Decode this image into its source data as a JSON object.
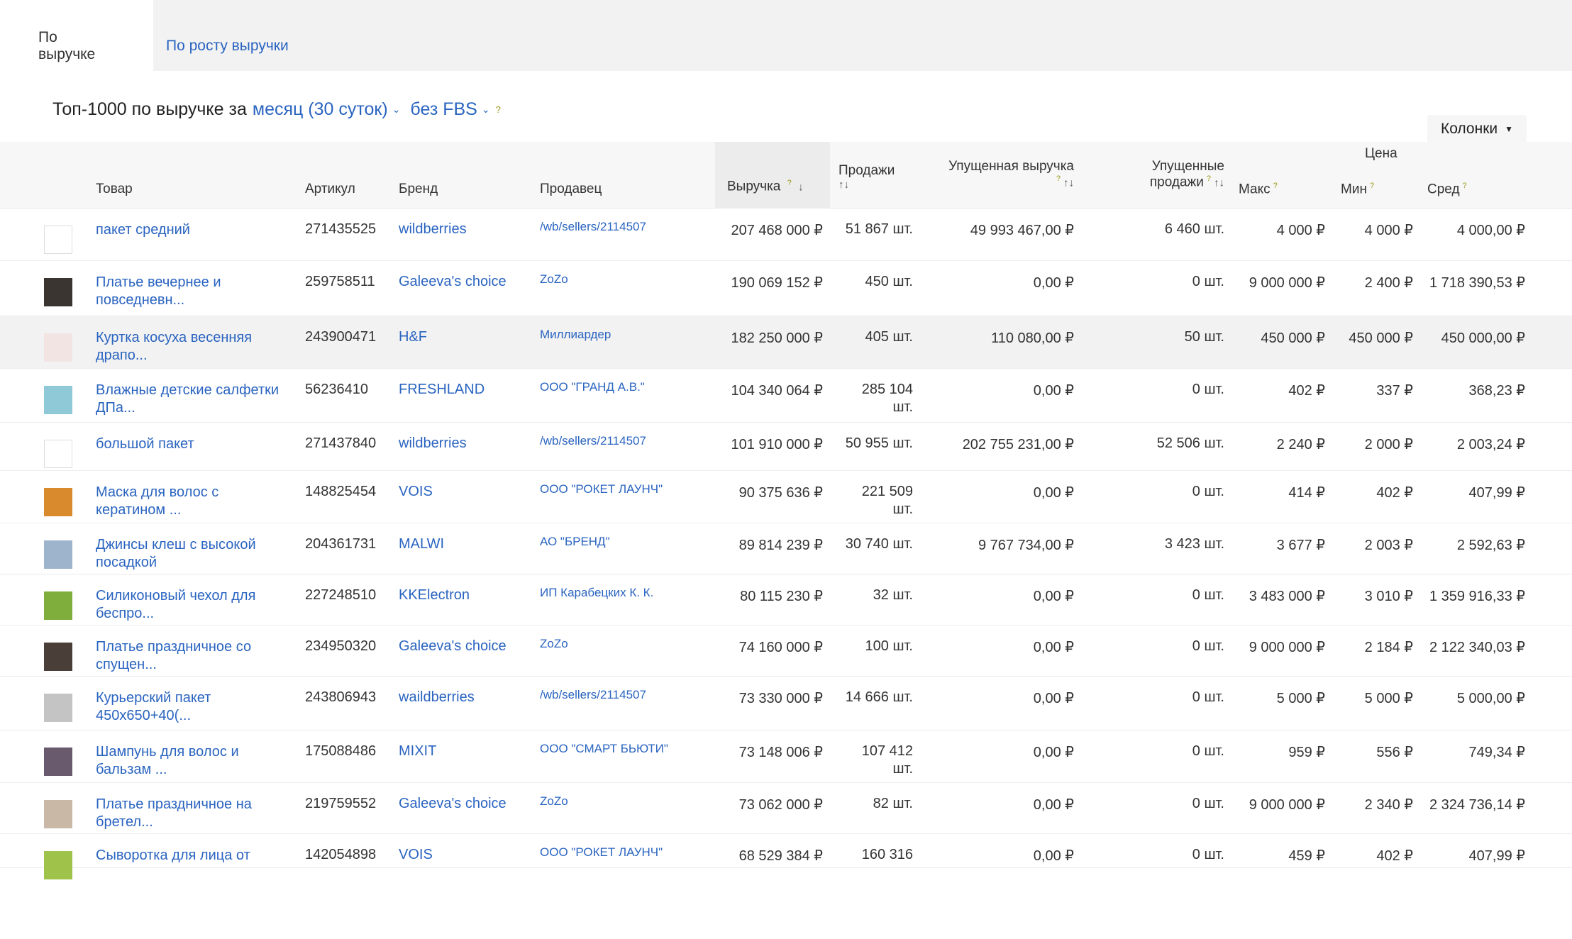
{
  "tabs": [
    {
      "label": "По выручке",
      "active": true
    },
    {
      "label": "По росту выручки",
      "active": false
    }
  ],
  "heading": {
    "prefix": "Топ-1000 по выручке за",
    "period": "месяц (30 суток)",
    "fbs": "без FBS",
    "help": "?"
  },
  "columns_button": "Колонки",
  "table": {
    "headers": {
      "product": "Товар",
      "article": "Артикул",
      "brand": "Бренд",
      "seller": "Продавец",
      "revenue": "Выручка",
      "sales": "Продажи",
      "lost_revenue": "Упущенная выручка",
      "lost_sales_1": "Упущенные",
      "lost_sales_2": "продажи",
      "price_group": "Цена",
      "price_max": "Макс",
      "price_min": "Мин",
      "price_avg": "Сред",
      "help": "?",
      "sort_desc": "↓",
      "sort_both": "↑↓"
    },
    "rows": [
      {
        "name": "пакет средний",
        "article": "271435525",
        "brand": "wildberries",
        "seller": "/wb/sellers/2114507",
        "revenue": "207 468 000 ₽",
        "sales": "51 867 шт.",
        "sales2": "",
        "lost_revenue": "49 993 467,00 ₽",
        "lost_sales": "6 460 шт.",
        "max": "4 000 ₽",
        "min": "4 000 ₽",
        "avg": "4 000,00 ₽",
        "thumb": "empty",
        "thumb_color": "#ffffff"
      },
      {
        "name": "Платье вечернее и повседневн...",
        "article": "259758511",
        "brand": "Galeeva's choice",
        "seller": "ZoZo",
        "revenue": "190 069 152 ₽",
        "sales": "450 шт.",
        "sales2": "",
        "lost_revenue": "0,00 ₽",
        "lost_sales": "0 шт.",
        "max": "9 000 000 ₽",
        "min": "2 400 ₽",
        "avg": "1 718 390,53 ₽",
        "thumb": "photo",
        "thumb_color": "#3a3530"
      },
      {
        "name": "Куртка косуха весенняя драпо...",
        "article": "243900471",
        "brand": "H&F",
        "seller": "Миллиардер",
        "revenue": "182 250 000 ₽",
        "sales": "405 шт.",
        "sales2": "",
        "lost_revenue": "110 080,00 ₽",
        "lost_sales": "50 шт.",
        "max": "450 000 ₽",
        "min": "450 000 ₽",
        "avg": "450 000,00 ₽",
        "thumb": "photo",
        "thumb_color": "#f3e4e4"
      },
      {
        "name": "Влажные детские салфетки ДПа...",
        "article": "56236410",
        "brand": "FRESHLAND",
        "seller": "ООО \"ГРАНД А.В.\"",
        "revenue": "104 340 064 ₽",
        "sales": "285 104",
        "sales2": "шт.",
        "lost_revenue": "0,00 ₽",
        "lost_sales": "0 шт.",
        "max": "402 ₽",
        "min": "337 ₽",
        "avg": "368,23 ₽",
        "thumb": "photo",
        "thumb_color": "#8fc9d8"
      },
      {
        "name": "большой пакет",
        "article": "271437840",
        "brand": "wildberries",
        "seller": "/wb/sellers/2114507",
        "revenue": "101 910 000 ₽",
        "sales": "50 955 шт.",
        "sales2": "",
        "lost_revenue": "202 755 231,00 ₽",
        "lost_sales": "52 506 шт.",
        "max": "2 240 ₽",
        "min": "2 000 ₽",
        "avg": "2 003,24 ₽",
        "thumb": "empty",
        "thumb_color": "#ffffff"
      },
      {
        "name": "Маска для волос с кератином ...",
        "article": "148825454",
        "brand": "VOIS",
        "seller": "ООО \"РОКЕТ ЛАУНЧ\"",
        "revenue": "90 375 636 ₽",
        "sales": "221 509",
        "sales2": "шт.",
        "lost_revenue": "0,00 ₽",
        "lost_sales": "0 шт.",
        "max": "414 ₽",
        "min": "402 ₽",
        "avg": "407,99 ₽",
        "thumb": "photo",
        "thumb_color": "#d88a2c"
      },
      {
        "name": "Джинсы клеш с высокой посадкой",
        "article": "204361731",
        "brand": "MALWI",
        "seller": "АО \"БРЕНД\"",
        "revenue": "89 814 239 ₽",
        "sales": "30 740 шт.",
        "sales2": "",
        "lost_revenue": "9 767 734,00 ₽",
        "lost_sales": "3 423 шт.",
        "max": "3 677 ₽",
        "min": "2 003 ₽",
        "avg": "2 592,63 ₽",
        "thumb": "photo",
        "thumb_color": "#9db4cc"
      },
      {
        "name": "Силиконовый чехол для беспро...",
        "article": "227248510",
        "brand": "KKElectron",
        "seller": "ИП Карабецких К. К.",
        "revenue": "80 115 230 ₽",
        "sales": "32 шт.",
        "sales2": "",
        "lost_revenue": "0,00 ₽",
        "lost_sales": "0 шт.",
        "max": "3 483 000 ₽",
        "min": "3 010 ₽",
        "avg": "1 359 916,33 ₽",
        "thumb": "photo",
        "thumb_color": "#7fae3c"
      },
      {
        "name": "Платье праздничное со спущен...",
        "article": "234950320",
        "brand": "Galeeva's choice",
        "seller": "ZoZo",
        "revenue": "74 160 000 ₽",
        "sales": "100 шт.",
        "sales2": "",
        "lost_revenue": "0,00 ₽",
        "lost_sales": "0 шт.",
        "max": "9 000 000 ₽",
        "min": "2 184 ₽",
        "avg": "2 122 340,03 ₽",
        "thumb": "photo",
        "thumb_color": "#4a3f38"
      },
      {
        "name": "Курьерский пакет 450x650+40(...",
        "article": "243806943",
        "brand": "waildberries",
        "seller": "/wb/sellers/2114507",
        "revenue": "73 330 000 ₽",
        "sales": "14 666 шт.",
        "sales2": "",
        "lost_revenue": "0,00 ₽",
        "lost_sales": "0 шт.",
        "max": "5 000 ₽",
        "min": "5 000 ₽",
        "avg": "5 000,00 ₽",
        "thumb": "photo",
        "thumb_color": "#c4c4c4"
      },
      {
        "name": "Шампунь для волос и бальзам ...",
        "article": "175088486",
        "brand": "MIXIT",
        "seller": "ООО \"СМАРТ БЬЮТИ\"",
        "revenue": "73 148 006 ₽",
        "sales": "107 412",
        "sales2": "шт.",
        "lost_revenue": "0,00 ₽",
        "lost_sales": "0 шт.",
        "max": "959 ₽",
        "min": "556 ₽",
        "avg": "749,34 ₽",
        "thumb": "photo",
        "thumb_color": "#6a5a6e"
      },
      {
        "name": "Платье праздничное на бретел...",
        "article": "219759552",
        "brand": "Galeeva's choice",
        "seller": "ZoZo",
        "revenue": "73 062 000 ₽",
        "sales": "82 шт.",
        "sales2": "",
        "lost_revenue": "0,00 ₽",
        "lost_sales": "0 шт.",
        "max": "9 000 000 ₽",
        "min": "2 340 ₽",
        "avg": "2 324 736,14 ₽",
        "thumb": "photo",
        "thumb_color": "#c9b8a6"
      },
      {
        "name": "Сыворотка для лица от",
        "article": "142054898",
        "brand": "VOIS",
        "seller": "ООО \"РОКЕТ ЛАУНЧ\"",
        "revenue": "68 529 384 ₽",
        "sales": "160 316",
        "sales2": "",
        "lost_revenue": "0,00 ₽",
        "lost_sales": "0 шт.",
        "max": "459 ₽",
        "min": "402 ₽",
        "avg": "407,99 ₽",
        "thumb": "photo",
        "thumb_color": "#9fc24a"
      }
    ]
  }
}
